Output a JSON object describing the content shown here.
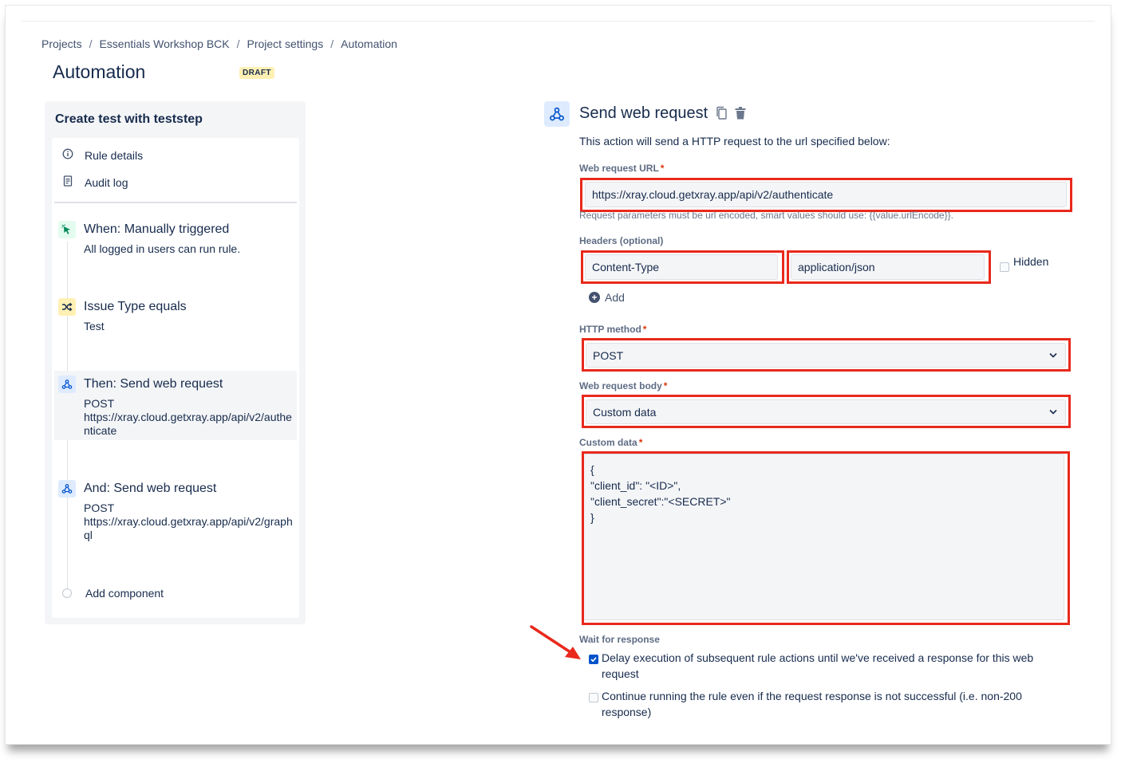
{
  "breadcrumb": {
    "items": [
      "Projects",
      "Essentials Workshop BCK",
      "Project settings",
      "Automation"
    ],
    "separator": "/"
  },
  "page": {
    "title": "Automation",
    "status_badge": "DRAFT"
  },
  "rule": {
    "name": "Create test with teststep",
    "nav": [
      {
        "label": "Rule details",
        "icon": "info-icon"
      },
      {
        "label": "Audit log",
        "icon": "document-icon"
      }
    ],
    "steps": [
      {
        "title": "When: Manually triggered",
        "description": "All logged in users can run rule.",
        "icon": "cursor-click-icon",
        "type": "trigger"
      },
      {
        "title": "Issue Type equals",
        "description": "Test",
        "icon": "shuffle-icon",
        "type": "condition"
      },
      {
        "title": "Then: Send web request",
        "method": "POST",
        "url": "https://xray.cloud.getxray.app/api/v2/authenticate",
        "icon": "webhook-icon",
        "type": "action",
        "selected": true
      },
      {
        "title": "And: Send web request",
        "method": "POST",
        "url": "https://xray.cloud.getxray.app/api/v2/graphql",
        "icon": "webhook-icon",
        "type": "action"
      }
    ],
    "add_component": "Add component"
  },
  "action": {
    "title": "Send web request",
    "icon": "webhook-icon",
    "description": "This action will send a HTTP request to the url specified below:",
    "url_label": "Web request URL",
    "url_value": "https://xray.cloud.getxray.app/api/v2/authenticate",
    "url_help": "Request parameters must be url encoded, smart values should use: {{value.urlEncode}}.",
    "headers_label": "Headers (optional)",
    "header_name": "Content-Type",
    "header_value": "application/json",
    "hidden_label": "Hidden",
    "hidden_checked": false,
    "add_label": "Add",
    "method_label": "HTTP method",
    "method_value": "POST",
    "body_label": "Web request body",
    "body_value": "Custom data",
    "custom_data_label": "Custom data",
    "custom_data_value": "{\n\"client_id\": \"<ID>\",\n\"client_secret\":\"<SECRET>\"\n}",
    "required_marker": "*",
    "wait_label": "Wait for response",
    "delay_option": "Delay execution of subsequent rule actions until we've received a response for this web request",
    "delay_checked": true,
    "continue_option": "Continue running the rule even if the request response is not successful (i.e. non-200 response)",
    "continue_checked": false
  },
  "colors": {
    "highlight": "#e8291c",
    "primary": "#0052cc",
    "text": "#172b4d",
    "subtle_text": "#5e6c84",
    "panel_bg": "#f4f5f7"
  }
}
